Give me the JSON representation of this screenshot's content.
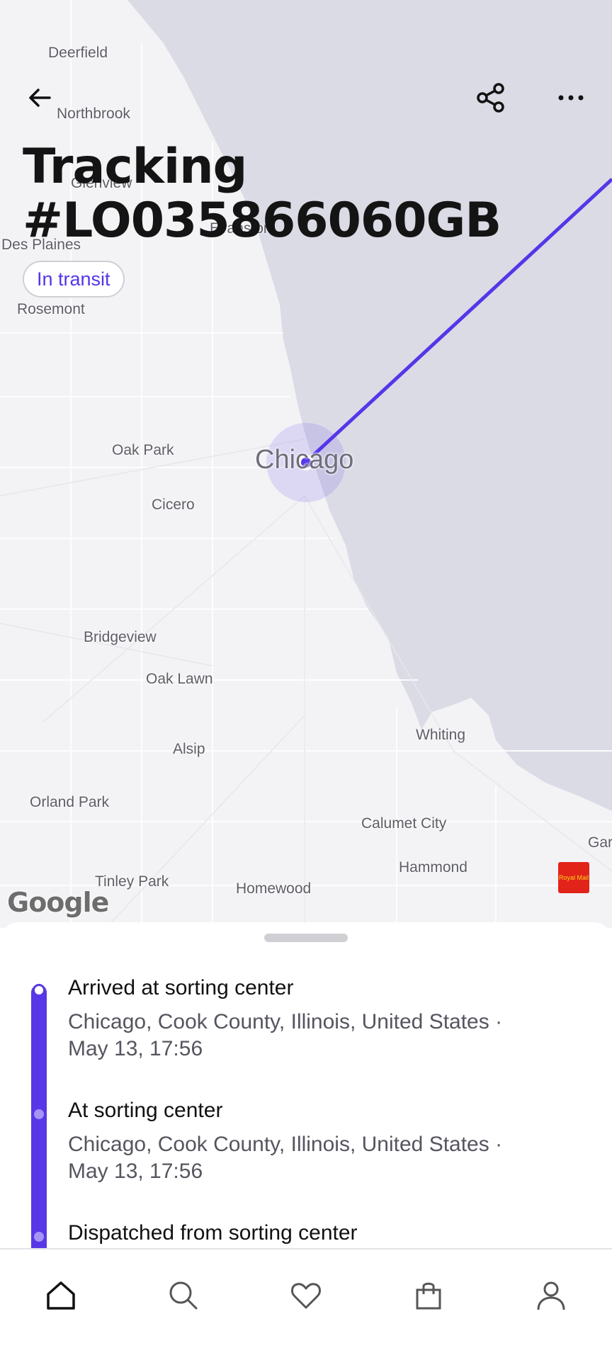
{
  "header": {
    "title_line1": "Tracking",
    "title_line2": "#LO035866060GB",
    "status": "In transit",
    "back_icon": "arrow-left-icon",
    "share_icon": "share-icon",
    "more_icon": "more-horizontal-icon"
  },
  "map": {
    "labels": [
      "Deerfield",
      "Northbrook",
      "Glenview",
      "Evanston",
      "Des Plaines",
      "Rosemont",
      "Oak Park",
      "Chicago",
      "Cicero",
      "Bridgeview",
      "Oak Lawn",
      "Whiting",
      "Alsip",
      "Orland Park",
      "Calumet City",
      "Gar",
      "Hammond",
      "Tinley Park",
      "Homewood"
    ],
    "attribution": "Google",
    "carrier_logo_text": "Royal Mail"
  },
  "timeline": {
    "events": [
      {
        "title": "Arrived at sorting center",
        "location": "Chicago, Cook County, Illinois, United States ·",
        "time": "May 13, 17:56"
      },
      {
        "title": "At sorting center",
        "location": "Chicago, Cook County, Illinois, United States ·",
        "time": "May 13, 17:56"
      },
      {
        "title": "Dispatched from sorting center"
      }
    ]
  },
  "nav": {
    "items": [
      "home-icon",
      "search-icon",
      "heart-icon",
      "bag-icon",
      "profile-icon"
    ],
    "active": "home-icon"
  },
  "colors": {
    "accent": "#5536e8",
    "water": "#dbdbe6",
    "land": "#f3f3f6"
  }
}
